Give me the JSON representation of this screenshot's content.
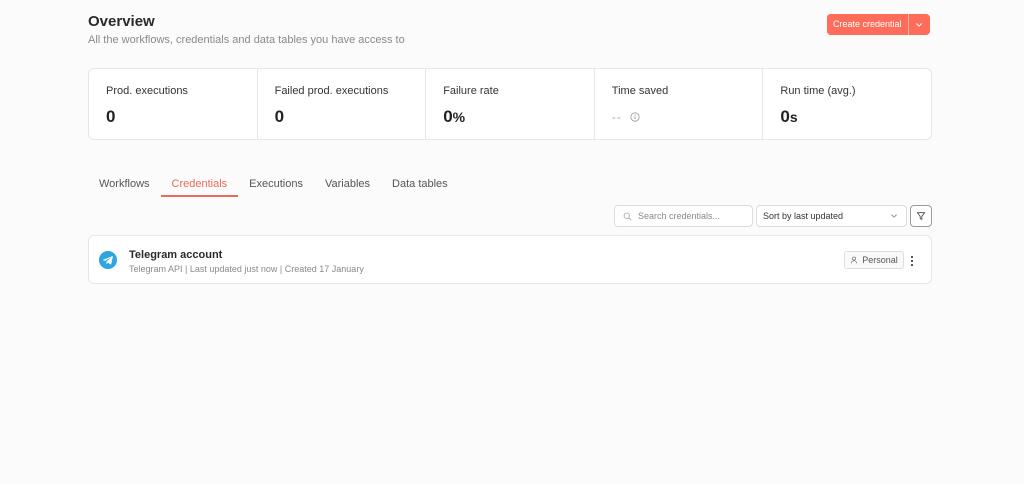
{
  "header": {
    "title": "Overview",
    "subtitle": "All the workflows, credentials and data tables you have access to",
    "create_label": "Create credential"
  },
  "colors": {
    "accent": "#ff6d5a",
    "active_tab": "#ea6b57",
    "telegram": "#2ca5e0"
  },
  "stats": [
    {
      "label": "Prod. executions",
      "value": "0",
      "suffix": ""
    },
    {
      "label": "Failed prod. executions",
      "value": "0",
      "suffix": ""
    },
    {
      "label": "Failure rate",
      "value": "0",
      "suffix": "%"
    },
    {
      "label": "Time saved",
      "value": "--",
      "suffix": "",
      "icon": "info-icon"
    },
    {
      "label": "Run time (avg.)",
      "value": "0",
      "suffix": "s"
    }
  ],
  "tabs": [
    {
      "label": "Workflows",
      "active": false
    },
    {
      "label": "Credentials",
      "active": true
    },
    {
      "label": "Executions",
      "active": false
    },
    {
      "label": "Variables",
      "active": false
    },
    {
      "label": "Data tables",
      "active": false
    }
  ],
  "controls": {
    "search_placeholder": "Search credentials...",
    "search_value": "",
    "sort_label": "Sort by last updated"
  },
  "credentials": [
    {
      "name": "Telegram account",
      "meta": "Telegram API | Last updated just now | Created 17 January",
      "owner": "Personal",
      "icon": "telegram-icon"
    }
  ]
}
